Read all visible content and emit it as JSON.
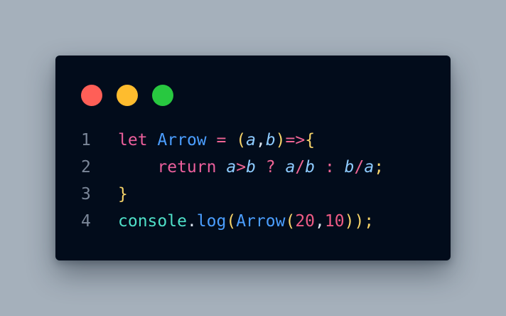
{
  "window": {
    "controls": [
      {
        "name": "close",
        "color": "#ff5f57"
      },
      {
        "name": "minimize",
        "color": "#febc2e"
      },
      {
        "name": "maximize",
        "color": "#28c840"
      }
    ]
  },
  "code": {
    "lines": [
      {
        "number": "1",
        "tokens": [
          {
            "t": "let",
            "c": "kw"
          },
          {
            "t": " ",
            "c": "plain"
          },
          {
            "t": "Arrow",
            "c": "fn"
          },
          {
            "t": " ",
            "c": "plain"
          },
          {
            "t": "=",
            "c": "op"
          },
          {
            "t": " ",
            "c": "plain"
          },
          {
            "t": "(",
            "c": "br"
          },
          {
            "t": "a",
            "c": "prm"
          },
          {
            "t": ",",
            "c": "plain"
          },
          {
            "t": "b",
            "c": "prm"
          },
          {
            "t": ")",
            "c": "br"
          },
          {
            "t": "=>",
            "c": "op"
          },
          {
            "t": "{",
            "c": "br"
          }
        ]
      },
      {
        "number": "2",
        "tokens": [
          {
            "t": "    ",
            "c": "plain"
          },
          {
            "t": "return",
            "c": "kw"
          },
          {
            "t": " ",
            "c": "plain"
          },
          {
            "t": "a",
            "c": "prm"
          },
          {
            "t": ">",
            "c": "op"
          },
          {
            "t": "b",
            "c": "prm"
          },
          {
            "t": " ",
            "c": "plain"
          },
          {
            "t": "?",
            "c": "op"
          },
          {
            "t": " ",
            "c": "plain"
          },
          {
            "t": "a",
            "c": "prm"
          },
          {
            "t": "/",
            "c": "op"
          },
          {
            "t": "b",
            "c": "prm"
          },
          {
            "t": " ",
            "c": "plain"
          },
          {
            "t": ":",
            "c": "op"
          },
          {
            "t": " ",
            "c": "plain"
          },
          {
            "t": "b",
            "c": "prm"
          },
          {
            "t": "/",
            "c": "op"
          },
          {
            "t": "a",
            "c": "prm"
          },
          {
            "t": ";",
            "c": "br"
          }
        ]
      },
      {
        "number": "3",
        "tokens": [
          {
            "t": "}",
            "c": "br"
          }
        ]
      },
      {
        "number": "4",
        "tokens": [
          {
            "t": "console",
            "c": "obj"
          },
          {
            "t": ".",
            "c": "plain"
          },
          {
            "t": "log",
            "c": "fn"
          },
          {
            "t": "(",
            "c": "br"
          },
          {
            "t": "Arrow",
            "c": "fn"
          },
          {
            "t": "(",
            "c": "br"
          },
          {
            "t": "20",
            "c": "num"
          },
          {
            "t": ",",
            "c": "plain"
          },
          {
            "t": "10",
            "c": "num"
          },
          {
            "t": ")",
            "c": "br"
          },
          {
            "t": ")",
            "c": "br"
          },
          {
            "t": ";",
            "c": "br"
          }
        ]
      }
    ]
  }
}
